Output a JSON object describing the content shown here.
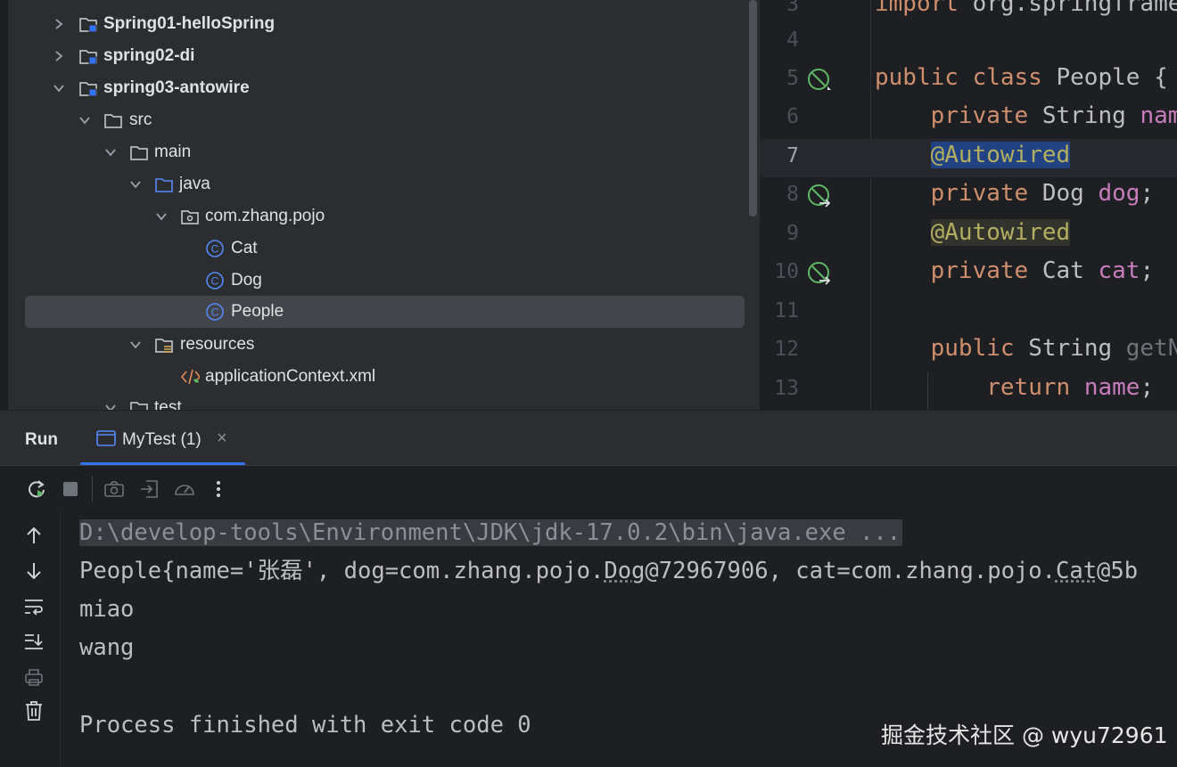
{
  "project_tree": {
    "rows": [
      {
        "label": "Spring01-helloSpring",
        "kind": "module",
        "expanded": false
      },
      {
        "label": "spring02-di",
        "kind": "module",
        "expanded": false
      },
      {
        "label": "spring03-antowire",
        "kind": "module",
        "expanded": true
      },
      {
        "label": "src",
        "kind": "folder",
        "expanded": true
      },
      {
        "label": "main",
        "kind": "folder",
        "expanded": true
      },
      {
        "label": "java",
        "kind": "source-folder",
        "expanded": true
      },
      {
        "label": "com.zhang.pojo",
        "kind": "package",
        "expanded": true
      },
      {
        "label": "Cat",
        "kind": "class"
      },
      {
        "label": "Dog",
        "kind": "class"
      },
      {
        "label": "People",
        "kind": "class",
        "selected": true
      },
      {
        "label": "resources",
        "kind": "resources-folder",
        "expanded": true
      },
      {
        "label": "applicationContext.xml",
        "kind": "xml"
      },
      {
        "label": "test",
        "kind": "folder",
        "expanded": true
      }
    ]
  },
  "editor": {
    "lines": [
      {
        "num": "3",
        "text": "import org.springframe"
      },
      {
        "num": "4",
        "text": ""
      },
      {
        "num": "5",
        "text": "public class People {"
      },
      {
        "num": "6",
        "text": "    private String nam"
      },
      {
        "num": "7",
        "text": "    @Autowired"
      },
      {
        "num": "8",
        "text": "    private Dog dog;"
      },
      {
        "num": "9",
        "text": "    @Autowired"
      },
      {
        "num": "10",
        "text": "    private Cat cat;"
      },
      {
        "num": "11",
        "text": ""
      },
      {
        "num": "12",
        "text": "    public String getN"
      },
      {
        "num": "13",
        "text": "        return name;"
      }
    ],
    "current_line": "7"
  },
  "run_panel": {
    "title": "Run",
    "tab_label": "MyTest (1)",
    "tab_close": "×",
    "toolbar_icons": [
      "rerun-icon",
      "stop-icon",
      "screenshot-icon",
      "restore-layout-icon",
      "profiler-icon",
      "more-icon"
    ],
    "side_icons": [
      "arrow-up-icon",
      "arrow-down-icon",
      "soft-wrap-icon",
      "scroll-to-end-icon",
      "print-icon",
      "trash-icon"
    ]
  },
  "console": {
    "command": "D:\\develop-tools\\Environment\\JDK\\jdk-17.0.2\\bin\\java.exe ...",
    "output_lines": [
      "People{name='张磊', dog=com.zhang.pojo.Dog@72967906, cat=com.zhang.pojo.Cat@5b",
      "miao",
      "wang",
      "",
      "Process finished with exit code 0"
    ]
  },
  "watermark": "掘金技术社区 @ wyu72961",
  "colors": {
    "accent": "#3574f0",
    "keyword": "#cf8e6d",
    "field": "#c77dbb",
    "annotation": "#b3ae60",
    "selection": "#214283"
  }
}
